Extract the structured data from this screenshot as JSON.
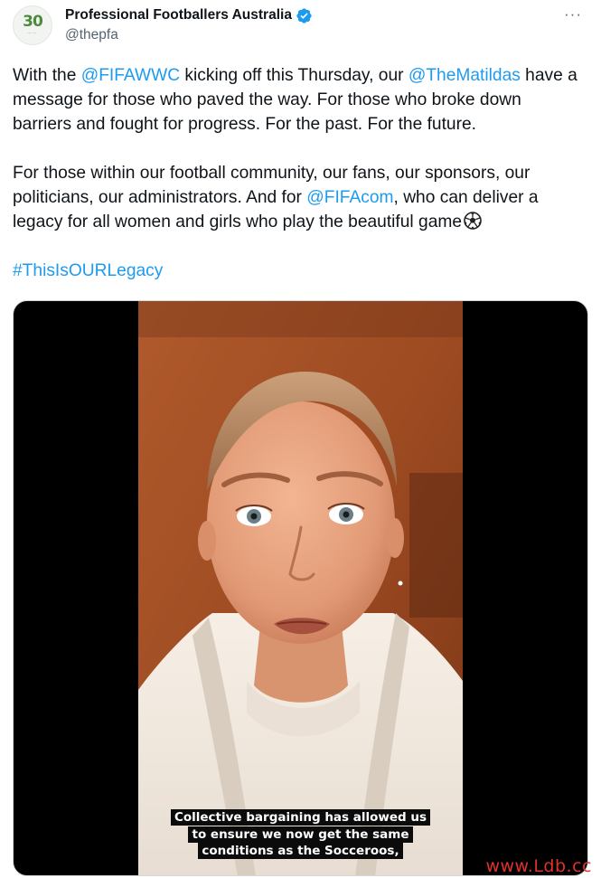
{
  "author": {
    "display_name": "Professional Footballers Australia",
    "handle": "@thepfa",
    "avatar_icon": "pfa-30-years-logo",
    "avatar_text": "30",
    "verified": true,
    "verified_color": "#1d9bf0"
  },
  "actions": {
    "more_label": "···"
  },
  "tweet": {
    "p1": {
      "l1_a": "With the ",
      "l1_mention1": "@FIFAWWC",
      "l1_b": " kicking off this Thursday, our ",
      "l1_mention2": "@TheMatildas",
      "l1_c": " have a",
      "l2": "message for those who paved the way. For those who broke down",
      "l3": "barriers and fought for progress. For the past. For the future."
    },
    "p2": {
      "l1": "For those within our football community, our fans, our sponsors, our",
      "l2_a": "politicians, our administrators. And for ",
      "l2_mention": "@FIFAcom",
      "l2_b": ", who can deliver a",
      "l3": "legacy for all women and girls who play the beautiful game",
      "emoji": "soccer-ball-icon"
    },
    "hashtag": "#ThisIsOURLegacy",
    "link_color": "#1d9bf0"
  },
  "video": {
    "caption_l1": "Collective bargaining has allowed us",
    "caption_l2": "to ensure we now get the same",
    "caption_l3": "conditions as the Socceroos,"
  },
  "watermark": "www.Ldb.cc"
}
